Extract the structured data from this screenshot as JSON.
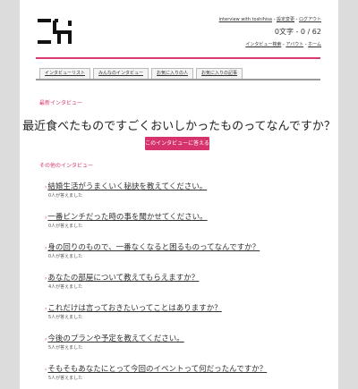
{
  "header": {
    "user_link": "interview with toshihisa",
    "separator": "-",
    "settings_link": "設定変更",
    "logout_link": "ログアウト",
    "char_count": "0文字 - 0 / 62",
    "nav": [
      "インタビュー検索",
      "アバウト",
      "ホーム"
    ]
  },
  "tabs": [
    "インタビューリスト",
    "みんなのインタビュー",
    "お気に入りの人",
    "お気に入りの記事"
  ],
  "latest": {
    "label": "最新インタビュー",
    "question": "最近食べたものですごくおいしかったものってなんですか？",
    "answer_button": "このインタビューに答える"
  },
  "others": {
    "label": "その他のインタビュー",
    "items": [
      {
        "question": "結婚生活がうまくいく秘訣を教えてください。",
        "count": "0人が答えました"
      },
      {
        "question": "一番ピンチだった時の事を聞かせてください。",
        "count": "0人が答えました"
      },
      {
        "question": "身の回りのもので、一番なくなると困るものってなんですか？",
        "count": "0人が答えました"
      },
      {
        "question": "あなたの部屋について教えてもらえますか？",
        "count": "4人が答えました"
      },
      {
        "question": "これだけは言っておきたいってことはありますか？",
        "count": "5人が答えました"
      },
      {
        "question": "今後のプランや予定を教えてください。",
        "count": "5人が答えました"
      },
      {
        "question": "そもそもあなたにとって今回のイベントって何だったんですか？",
        "count": "5人が答えました"
      }
    ]
  }
}
